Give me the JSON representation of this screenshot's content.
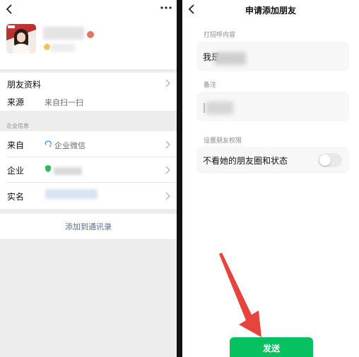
{
  "left": {
    "rows": {
      "friend_info_label": "朋友资料",
      "source_label": "来源",
      "source_value": "来自扫一扫"
    },
    "section_title": "企业信息",
    "from_label": "来自",
    "from_value": "企业微信",
    "company_label": "企业",
    "realname_label": "实名",
    "add_contact": "添加到通讯录",
    "accent_link_color": "#586c94"
  },
  "right": {
    "title": "申请添加朋友",
    "greeting_label": "打招呼内容",
    "greeting_value": "我是",
    "remark_label": "备注",
    "remark_value": "",
    "permission_label": "设置朋友权限",
    "hide_moments_label": "不看她的朋友圈和状态",
    "hide_moments_on": false,
    "send_label": "发送",
    "send_color": "#07c160",
    "arrow_color": "#e8443f"
  }
}
